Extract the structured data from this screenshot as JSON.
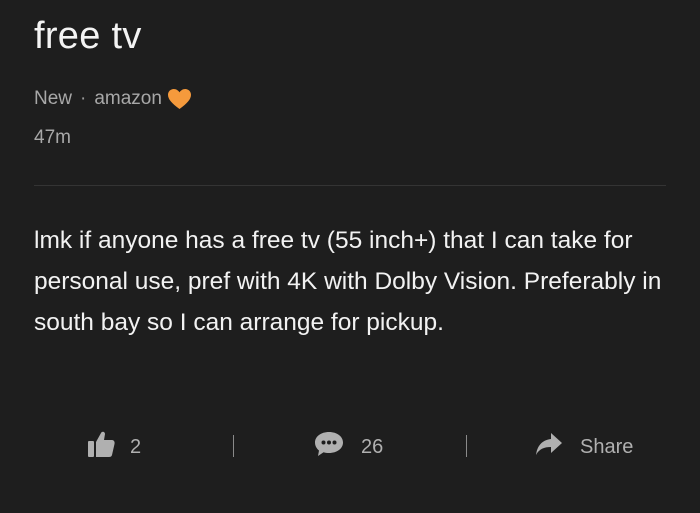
{
  "post": {
    "title": "free tv",
    "badge": "New",
    "separator": "·",
    "author": "amazon",
    "author_emoji": "orange-heart-icon",
    "timestamp": "47m",
    "body": "lmk if anyone has a free tv (55 inch+) that I can take for personal use, pref with 4K with Dolby Vision. Preferably in south bay so I can arrange for pickup."
  },
  "actions": {
    "like": {
      "icon": "thumbs-up-icon",
      "count": "2"
    },
    "comment": {
      "icon": "comment-bubble-icon",
      "count": "26"
    },
    "share": {
      "icon": "share-arrow-icon",
      "label": "Share"
    }
  },
  "colors": {
    "background": "#1e1e1e",
    "text_primary": "#f2f2f2",
    "text_secondary": "#a8a8a8",
    "heart": "#f59a3c"
  }
}
